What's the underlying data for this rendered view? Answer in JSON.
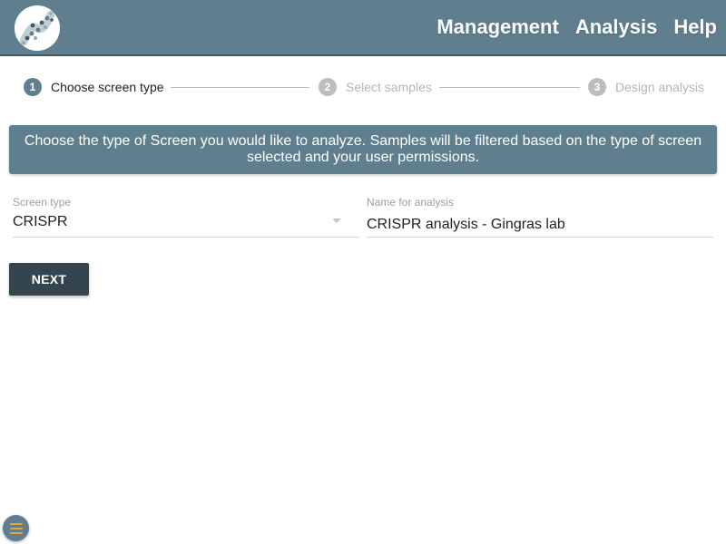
{
  "header": {
    "logo_icon": "dna-helix-logo-icon",
    "nav": [
      {
        "label": "Management"
      },
      {
        "label": "Analysis"
      },
      {
        "label": "Help"
      }
    ]
  },
  "stepper": {
    "steps": [
      {
        "number": "1",
        "label": "Choose screen type",
        "state": "active"
      },
      {
        "number": "2",
        "label": "Select samples",
        "state": "inactive"
      },
      {
        "number": "3",
        "label": "Design analysis",
        "state": "inactive"
      }
    ]
  },
  "banner": {
    "text": "Choose the type of Screen you would like to analyze. Samples will be filtered based on the type of screen selected and your user permissions."
  },
  "form": {
    "screen_type": {
      "label": "Screen type",
      "value": "CRISPR"
    },
    "analysis_name": {
      "label": "Name for analysis",
      "value": "CRISPR analysis - Gingras lab"
    }
  },
  "actions": {
    "next_label": "NEXT"
  },
  "fab": {
    "icon": "menu-icon"
  },
  "colors": {
    "primary": "#5f7f8f",
    "button_dark": "#344550",
    "accent": "#e8a33a"
  }
}
